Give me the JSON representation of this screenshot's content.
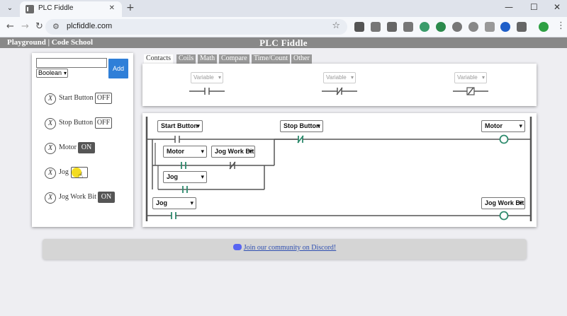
{
  "browser": {
    "tab_title": "PLC Fiddle",
    "url": "plcfiddle.com",
    "new_tab": "+",
    "tab_close": "✕",
    "menu_glyph": "⌄",
    "back": "←",
    "forward": "→",
    "reload": "↻",
    "site_info": "⚙",
    "bookmark": "☆",
    "window": {
      "minimize": "—",
      "maximize": "☐",
      "close": "✕"
    }
  },
  "app": {
    "title": "PLC Fiddle",
    "nav_playground": "Playground",
    "nav_separator": " | ",
    "nav_code_school": "Code School"
  },
  "variables": {
    "input_value": "",
    "type_selected": "Boolean",
    "add_label": "Add",
    "delete_glyph": "X",
    "items": [
      {
        "name": "Start Button",
        "state": "OFF"
      },
      {
        "name": "Stop Button",
        "state": "OFF"
      },
      {
        "name": "Motor",
        "state": "ON"
      },
      {
        "name": "Jog",
        "state": ""
      },
      {
        "name": "Jog Work Bit",
        "state": "ON"
      }
    ]
  },
  "palette": {
    "tabs": [
      "Contacts",
      "Coils",
      "Math",
      "Compare",
      "Time/Count",
      "Other"
    ],
    "active_tab": "Contacts",
    "items": [
      {
        "placeholder": "Variable",
        "kind": "normally-open"
      },
      {
        "placeholder": "Variable",
        "kind": "normally-closed"
      },
      {
        "placeholder": "Variable",
        "kind": "negated"
      }
    ]
  },
  "ladder": {
    "rung1": {
      "start": "Start Button",
      "stop": "Stop Button",
      "coil": "Motor",
      "branch_motor": "Motor",
      "branch_jogbit": "Jog Work Bit",
      "branch_jog": "Jog"
    },
    "rung2": {
      "contact": "Jog",
      "coil": "Jog Work Bit"
    },
    "energized_color": "#2e8b6d",
    "wire_color": "#555555"
  },
  "discord": {
    "label": "Join our community on Discord!"
  }
}
